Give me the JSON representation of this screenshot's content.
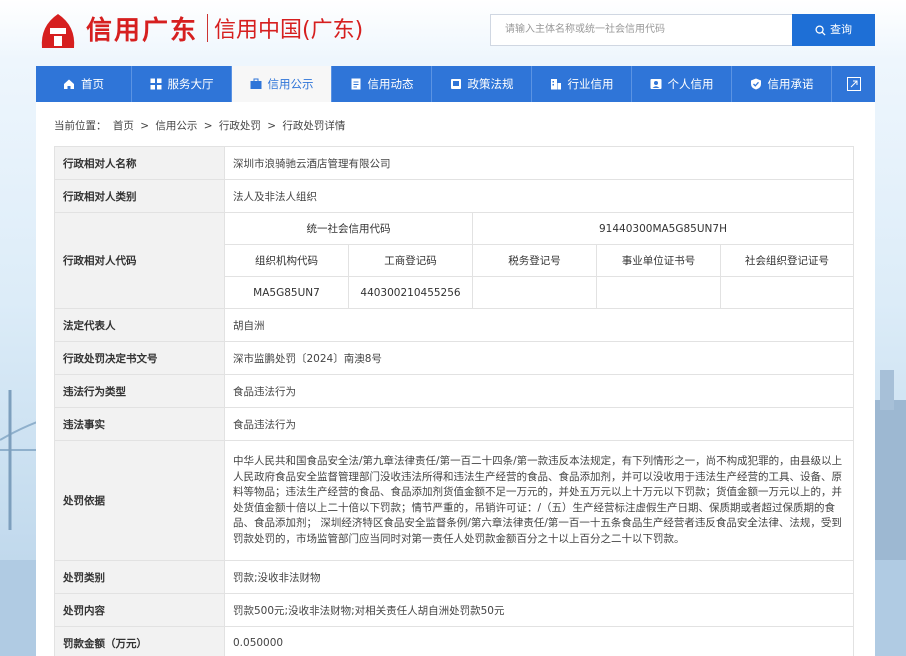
{
  "header": {
    "logo_text": "信用广东",
    "logo_sub": "信用中国(广东)",
    "search_placeholder": "请输入主体名称或统一社会信用代码",
    "search_button": "查询"
  },
  "nav": {
    "items": [
      {
        "label": "首页",
        "icon": "home-icon"
      },
      {
        "label": "服务大厅",
        "icon": "grid-icon"
      },
      {
        "label": "信用公示",
        "icon": "briefcase-icon",
        "active": true
      },
      {
        "label": "信用动态",
        "icon": "document-icon"
      },
      {
        "label": "政策法规",
        "icon": "book-icon"
      },
      {
        "label": "行业信用",
        "icon": "building-icon"
      },
      {
        "label": "个人信用",
        "icon": "person-card-icon"
      },
      {
        "label": "信用承诺",
        "icon": "shield-icon"
      }
    ]
  },
  "breadcrumb": {
    "prefix": "当前位置：",
    "items": [
      "首页",
      "信用公示",
      "行政处罚",
      "行政处罚详情"
    ],
    "sep": ">"
  },
  "details": {
    "name_label": "行政相对人名称",
    "name_value": "深圳市浪骑驰云酒店管理有限公司",
    "type_label": "行政相对人类别",
    "type_value": "法人及非法人组织",
    "code_label": "行政相对人代码",
    "usc_label": "统一社会信用代码",
    "usc_value": "91440300MA5G85UN7H",
    "sub_headers": [
      "组织机构代码",
      "工商登记码",
      "税务登记号",
      "事业单位证书号",
      "社会组织登记证号"
    ],
    "sub_values": [
      "MA5G85UN7",
      "440300210455256",
      "",
      "",
      ""
    ],
    "rep_label": "法定代表人",
    "rep_value": "胡自洲",
    "doc_label": "行政处罚决定书文号",
    "doc_value": "深市监鹏处罚〔2024〕南澳8号",
    "vtype_label": "违法行为类型",
    "vtype_value": "食品违法行为",
    "fact_label": "违法事实",
    "fact_value": "食品违法行为",
    "basis_label": "处罚依据",
    "basis_value": "中华人民共和国食品安全法/第九章法律责任/第一百二十四条/第一款违反本法规定，有下列情形之一，尚不构成犯罪的，由县级以上人民政府食品安全监督管理部门没收违法所得和违法生产经营的食品、食品添加剂，并可以没收用于违法生产经营的工具、设备、原料等物品；违法生产经营的食品、食品添加剂货值金额不足一万元的，并处五万元以上十万元以下罚款；货值金额一万元以上的，并处货值金额十倍以上二十倍以下罚款；情节严重的，吊销许可证：/（五）生产经营标注虚假生产日期、保质期或者超过保质期的食品、食品添加剂； 深圳经济特区食品安全监督条例/第六章法律责任/第一百一十五条食品生产经营者违反食品安全法律、法规，受到罚款处罚的，市场监管部门应当同时对第一责任人处罚款金额百分之十以上百分之二十以下罚款。",
    "ptype_label": "处罚类别",
    "ptype_value": "罚款;没收非法财物",
    "content_label": "处罚内容",
    "content_value": "罚款500元;没收非法财物;对相关责任人胡自洲处罚款50元",
    "amount_label": "罚款金额（万元）",
    "amount_value": "0.050000"
  }
}
